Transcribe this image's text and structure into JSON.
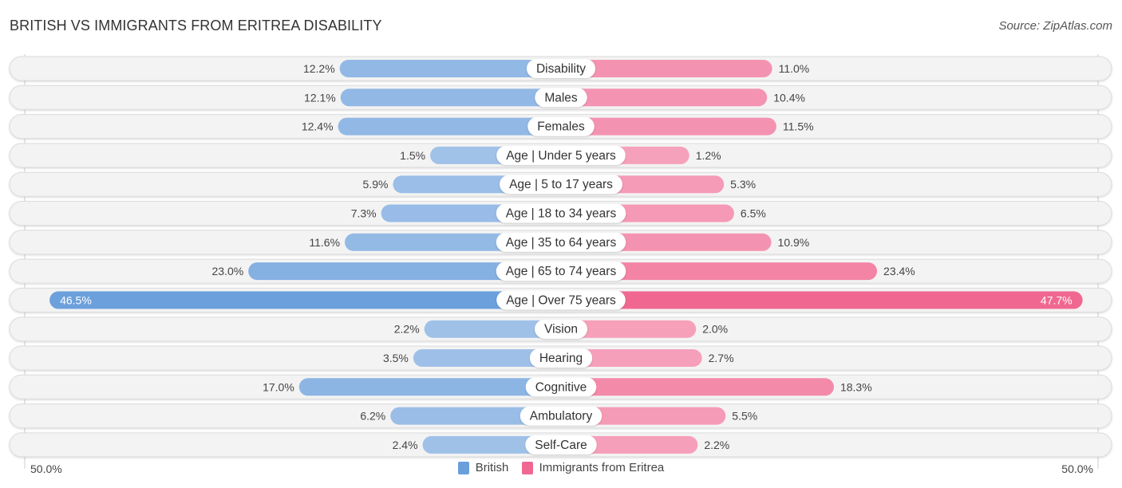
{
  "header": {
    "title": "BRITISH VS IMMIGRANTS FROM ERITREA DISABILITY",
    "source": "Source: ZipAtlas.com"
  },
  "colors": {
    "british": "#6a9fdc",
    "british_light": "#a3c3e9",
    "eritrea": "#f06891",
    "eritrea_light": "#f6a3bd"
  },
  "chart_data": {
    "type": "bar",
    "orientation": "horizontal-diverging",
    "title": "BRITISH VS IMMIGRANTS FROM ERITREA DISABILITY",
    "categories": [
      "Disability",
      "Males",
      "Females",
      "Age | Under 5 years",
      "Age | 5 to 17 years",
      "Age | 18 to 34 years",
      "Age | 35 to 64 years",
      "Age | 65 to 74 years",
      "Age | Over 75 years",
      "Vision",
      "Hearing",
      "Cognitive",
      "Ambulatory",
      "Self-Care"
    ],
    "series": [
      {
        "name": "British",
        "values": [
          12.2,
          12.1,
          12.4,
          1.5,
          5.9,
          7.3,
          11.6,
          23.0,
          46.5,
          2.2,
          3.5,
          17.0,
          6.2,
          2.4
        ]
      },
      {
        "name": "Immigrants from Eritrea",
        "values": [
          11.0,
          10.4,
          11.5,
          1.2,
          5.3,
          6.5,
          10.9,
          23.4,
          47.7,
          2.0,
          2.7,
          18.3,
          5.5,
          2.2
        ]
      }
    ],
    "axis": {
      "left_label": "50.0%",
      "right_label": "50.0%",
      "range": [
        0,
        50
      ]
    },
    "legend": {
      "position": "bottom-center",
      "entries": [
        "British",
        "Immigrants from Eritrea"
      ]
    },
    "value_suffix": "%"
  }
}
